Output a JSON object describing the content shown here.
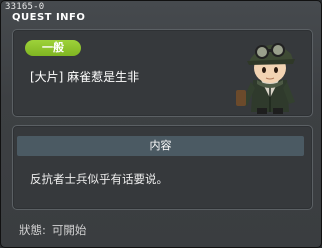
{
  "window": {
    "quest_id": "33165-0",
    "title": "QUEST INFO"
  },
  "quest": {
    "category_badge": "一般",
    "name": "[大片] 麻雀惹是生非",
    "npc_icon": "soldier-npc-icon"
  },
  "content": {
    "header": "内容",
    "description": "反抗者士兵似乎有话要说。"
  },
  "status": {
    "label": "狀態:",
    "value": "可開始"
  },
  "colors": {
    "badge": "#8cc42c",
    "header_bar": "#4b5a63",
    "background": "#3d4043"
  }
}
